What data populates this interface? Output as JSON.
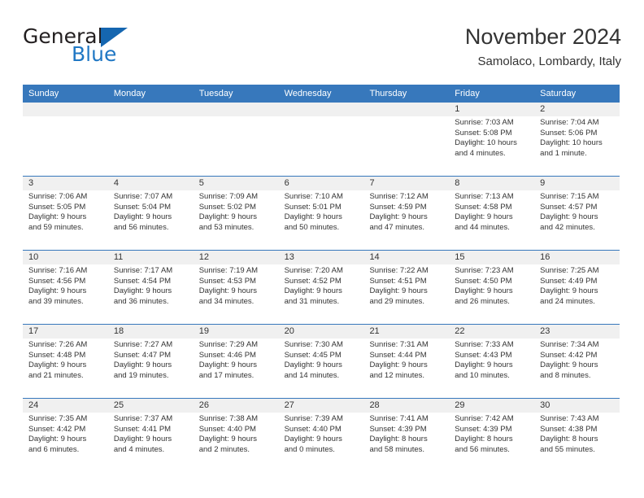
{
  "brand": {
    "name_top": "General",
    "name_bottom": "Blue",
    "triangle_color": "#1566b0",
    "blue_text_color": "#1f77c4"
  },
  "header": {
    "title": "November 2024",
    "subtitle": "Samolaco, Lombardy, Italy"
  },
  "theme": {
    "header_blue": "#3778bc",
    "day_head_gray": "#f0f0f0",
    "text": "#333333"
  },
  "weekdays": [
    "Sunday",
    "Monday",
    "Tuesday",
    "Wednesday",
    "Thursday",
    "Friday",
    "Saturday"
  ],
  "weeks": [
    [
      {
        "day": "",
        "lines": []
      },
      {
        "day": "",
        "lines": []
      },
      {
        "day": "",
        "lines": []
      },
      {
        "day": "",
        "lines": []
      },
      {
        "day": "",
        "lines": []
      },
      {
        "day": "1",
        "lines": [
          "Sunrise: 7:03 AM",
          "Sunset: 5:08 PM",
          "Daylight: 10 hours",
          "and 4 minutes."
        ]
      },
      {
        "day": "2",
        "lines": [
          "Sunrise: 7:04 AM",
          "Sunset: 5:06 PM",
          "Daylight: 10 hours",
          "and 1 minute."
        ]
      }
    ],
    [
      {
        "day": "3",
        "lines": [
          "Sunrise: 7:06 AM",
          "Sunset: 5:05 PM",
          "Daylight: 9 hours",
          "and 59 minutes."
        ]
      },
      {
        "day": "4",
        "lines": [
          "Sunrise: 7:07 AM",
          "Sunset: 5:04 PM",
          "Daylight: 9 hours",
          "and 56 minutes."
        ]
      },
      {
        "day": "5",
        "lines": [
          "Sunrise: 7:09 AM",
          "Sunset: 5:02 PM",
          "Daylight: 9 hours",
          "and 53 minutes."
        ]
      },
      {
        "day": "6",
        "lines": [
          "Sunrise: 7:10 AM",
          "Sunset: 5:01 PM",
          "Daylight: 9 hours",
          "and 50 minutes."
        ]
      },
      {
        "day": "7",
        "lines": [
          "Sunrise: 7:12 AM",
          "Sunset: 4:59 PM",
          "Daylight: 9 hours",
          "and 47 minutes."
        ]
      },
      {
        "day": "8",
        "lines": [
          "Sunrise: 7:13 AM",
          "Sunset: 4:58 PM",
          "Daylight: 9 hours",
          "and 44 minutes."
        ]
      },
      {
        "day": "9",
        "lines": [
          "Sunrise: 7:15 AM",
          "Sunset: 4:57 PM",
          "Daylight: 9 hours",
          "and 42 minutes."
        ]
      }
    ],
    [
      {
        "day": "10",
        "lines": [
          "Sunrise: 7:16 AM",
          "Sunset: 4:56 PM",
          "Daylight: 9 hours",
          "and 39 minutes."
        ]
      },
      {
        "day": "11",
        "lines": [
          "Sunrise: 7:17 AM",
          "Sunset: 4:54 PM",
          "Daylight: 9 hours",
          "and 36 minutes."
        ]
      },
      {
        "day": "12",
        "lines": [
          "Sunrise: 7:19 AM",
          "Sunset: 4:53 PM",
          "Daylight: 9 hours",
          "and 34 minutes."
        ]
      },
      {
        "day": "13",
        "lines": [
          "Sunrise: 7:20 AM",
          "Sunset: 4:52 PM",
          "Daylight: 9 hours",
          "and 31 minutes."
        ]
      },
      {
        "day": "14",
        "lines": [
          "Sunrise: 7:22 AM",
          "Sunset: 4:51 PM",
          "Daylight: 9 hours",
          "and 29 minutes."
        ]
      },
      {
        "day": "15",
        "lines": [
          "Sunrise: 7:23 AM",
          "Sunset: 4:50 PM",
          "Daylight: 9 hours",
          "and 26 minutes."
        ]
      },
      {
        "day": "16",
        "lines": [
          "Sunrise: 7:25 AM",
          "Sunset: 4:49 PM",
          "Daylight: 9 hours",
          "and 24 minutes."
        ]
      }
    ],
    [
      {
        "day": "17",
        "lines": [
          "Sunrise: 7:26 AM",
          "Sunset: 4:48 PM",
          "Daylight: 9 hours",
          "and 21 minutes."
        ]
      },
      {
        "day": "18",
        "lines": [
          "Sunrise: 7:27 AM",
          "Sunset: 4:47 PM",
          "Daylight: 9 hours",
          "and 19 minutes."
        ]
      },
      {
        "day": "19",
        "lines": [
          "Sunrise: 7:29 AM",
          "Sunset: 4:46 PM",
          "Daylight: 9 hours",
          "and 17 minutes."
        ]
      },
      {
        "day": "20",
        "lines": [
          "Sunrise: 7:30 AM",
          "Sunset: 4:45 PM",
          "Daylight: 9 hours",
          "and 14 minutes."
        ]
      },
      {
        "day": "21",
        "lines": [
          "Sunrise: 7:31 AM",
          "Sunset: 4:44 PM",
          "Daylight: 9 hours",
          "and 12 minutes."
        ]
      },
      {
        "day": "22",
        "lines": [
          "Sunrise: 7:33 AM",
          "Sunset: 4:43 PM",
          "Daylight: 9 hours",
          "and 10 minutes."
        ]
      },
      {
        "day": "23",
        "lines": [
          "Sunrise: 7:34 AM",
          "Sunset: 4:42 PM",
          "Daylight: 9 hours",
          "and 8 minutes."
        ]
      }
    ],
    [
      {
        "day": "24",
        "lines": [
          "Sunrise: 7:35 AM",
          "Sunset: 4:42 PM",
          "Daylight: 9 hours",
          "and 6 minutes."
        ]
      },
      {
        "day": "25",
        "lines": [
          "Sunrise: 7:37 AM",
          "Sunset: 4:41 PM",
          "Daylight: 9 hours",
          "and 4 minutes."
        ]
      },
      {
        "day": "26",
        "lines": [
          "Sunrise: 7:38 AM",
          "Sunset: 4:40 PM",
          "Daylight: 9 hours",
          "and 2 minutes."
        ]
      },
      {
        "day": "27",
        "lines": [
          "Sunrise: 7:39 AM",
          "Sunset: 4:40 PM",
          "Daylight: 9 hours",
          "and 0 minutes."
        ]
      },
      {
        "day": "28",
        "lines": [
          "Sunrise: 7:41 AM",
          "Sunset: 4:39 PM",
          "Daylight: 8 hours",
          "and 58 minutes."
        ]
      },
      {
        "day": "29",
        "lines": [
          "Sunrise: 7:42 AM",
          "Sunset: 4:39 PM",
          "Daylight: 8 hours",
          "and 56 minutes."
        ]
      },
      {
        "day": "30",
        "lines": [
          "Sunrise: 7:43 AM",
          "Sunset: 4:38 PM",
          "Daylight: 8 hours",
          "and 55 minutes."
        ]
      }
    ]
  ]
}
